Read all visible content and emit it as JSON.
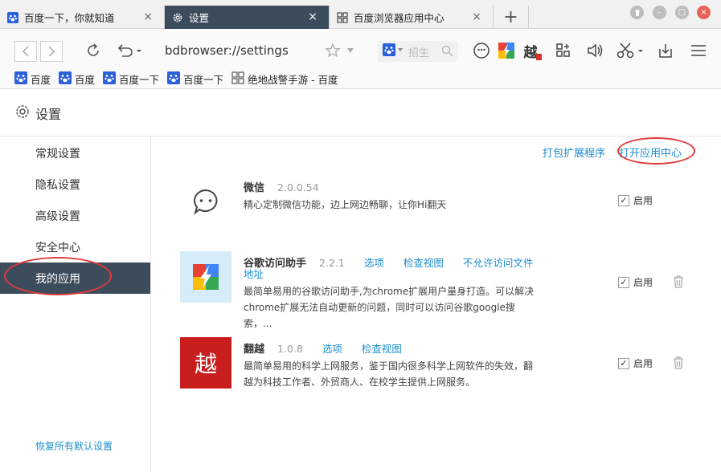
{
  "tabs": [
    {
      "label": "百度一下，你就知道",
      "close": "×"
    },
    {
      "label": "设置",
      "close": "×"
    },
    {
      "label": "百度浏览器应用中心",
      "close": "×"
    }
  ],
  "new_tab": "+",
  "window_controls": {
    "minimize": "–",
    "maximize": "□",
    "close": "×"
  },
  "toolbar": {
    "url": "bdbrowser://settings",
    "search_placeholder": "招生",
    "extension_icons": [
      "wechat-icon",
      "google-helper-icon",
      "fanyue-icon",
      "app-grid-icon",
      "speaker-icon",
      "scissors-icon",
      "download-icon",
      "menu-icon"
    ]
  },
  "bookmarks": [
    "百度",
    "百度",
    "百度一下",
    "百度一下",
    "绝地战警手游 - 百度"
  ],
  "header": {
    "title": "设置"
  },
  "sidebar": {
    "items": [
      "常规设置",
      "隐私设置",
      "高级设置",
      "安全中心",
      "我的应用"
    ],
    "active_index": 4,
    "restore_label": "恢复所有默认设置"
  },
  "content": {
    "pack_extension": "打包扩展程序",
    "open_app_center": "打开应用中心",
    "extensions": [
      {
        "name": "微信",
        "version": "2.0.0.54",
        "links": [],
        "desc": "精心定制微信功能，边上网边畅聊，让你Hi翻天",
        "enabled_label": "启用",
        "enabled": true,
        "deletable": false
      },
      {
        "name": "谷歌访问助手",
        "version": "2.2.1",
        "links": [
          "选项",
          "检查视图",
          "不允许访问文件"
        ],
        "links_wrap": "地址",
        "desc": "最简单易用的谷歌访问助手,为chrome扩展用户量身打造。可以解决chrome扩展无法自动更新的问题，同时可以访问谷歌google搜索，...",
        "enabled_label": "启用",
        "enabled": true,
        "deletable": true
      },
      {
        "name": "翻越",
        "version": "1.0.8",
        "links": [
          "选项",
          "检查视图"
        ],
        "logo_text": "越",
        "desc": "最简单易用的科学上网服务，鉴于国内很多科学上网软件的失效，翻越为科技工作者、外贸商人、在校学生提供上网服务。",
        "enabled_label": "启用",
        "enabled": true,
        "deletable": true
      }
    ]
  },
  "colors": {
    "accent": "#1d8ecf",
    "sidebar_active": "#3d4c5c",
    "annotation": "#e03b3b"
  }
}
